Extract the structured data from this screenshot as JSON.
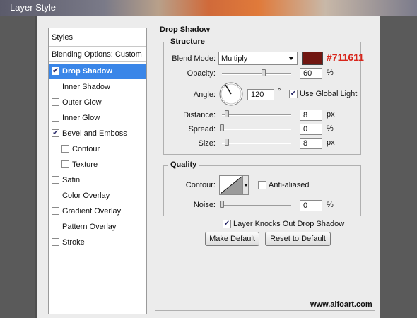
{
  "window": {
    "title": "Layer Style"
  },
  "sidebar": {
    "header": "Styles",
    "blending_options": "Blending Options: Custom",
    "items": [
      {
        "label": "Drop Shadow",
        "checked": true,
        "selected": true,
        "indent": false
      },
      {
        "label": "Inner Shadow",
        "checked": false,
        "selected": false,
        "indent": false
      },
      {
        "label": "Outer Glow",
        "checked": false,
        "selected": false,
        "indent": false
      },
      {
        "label": "Inner Glow",
        "checked": false,
        "selected": false,
        "indent": false
      },
      {
        "label": "Bevel and Emboss",
        "checked": true,
        "selected": false,
        "indent": false
      },
      {
        "label": "Contour",
        "checked": false,
        "selected": false,
        "indent": true
      },
      {
        "label": "Texture",
        "checked": false,
        "selected": false,
        "indent": true
      },
      {
        "label": "Satin",
        "checked": false,
        "selected": false,
        "indent": false
      },
      {
        "label": "Color Overlay",
        "checked": false,
        "selected": false,
        "indent": false
      },
      {
        "label": "Gradient Overlay",
        "checked": false,
        "selected": false,
        "indent": false
      },
      {
        "label": "Pattern Overlay",
        "checked": false,
        "selected": false,
        "indent": false
      },
      {
        "label": "Stroke",
        "checked": false,
        "selected": false,
        "indent": false
      }
    ]
  },
  "drop_shadow": {
    "title": "Drop Shadow",
    "structure": {
      "legend": "Structure",
      "blend_mode_label": "Blend Mode:",
      "blend_mode_value": "Multiply",
      "shadow_color": "#711611",
      "color_annotation": "#711611",
      "opacity_label": "Opacity:",
      "opacity_value": "60",
      "opacity_unit": "%",
      "opacity_level": 0.6,
      "angle_label": "Angle:",
      "angle_value": "120",
      "angle_unit": "°",
      "use_global_light_label": "Use Global Light",
      "use_global_light": true,
      "distance_label": "Distance:",
      "distance_value": "8",
      "distance_unit": "px",
      "distance_level": 0.03,
      "spread_label": "Spread:",
      "spread_value": "0",
      "spread_unit": "%",
      "spread_level": 0,
      "size_label": "Size:",
      "size_value": "8",
      "size_unit": "px",
      "size_level": 0.03
    },
    "quality": {
      "legend": "Quality",
      "contour_label": "Contour:",
      "anti_aliased_label": "Anti-aliased",
      "anti_aliased": false,
      "noise_label": "Noise:",
      "noise_value": "0",
      "noise_unit": "%",
      "noise_level": 0
    },
    "layer_knocks_out_label": "Layer Knocks Out Drop Shadow",
    "layer_knocks_out": true,
    "make_default_label": "Make Default",
    "reset_default_label": "Reset to Default"
  },
  "watermark": "www.alfoart.com",
  "colors": {
    "selection": "#3a86e8",
    "annotation": "#d8251b"
  }
}
